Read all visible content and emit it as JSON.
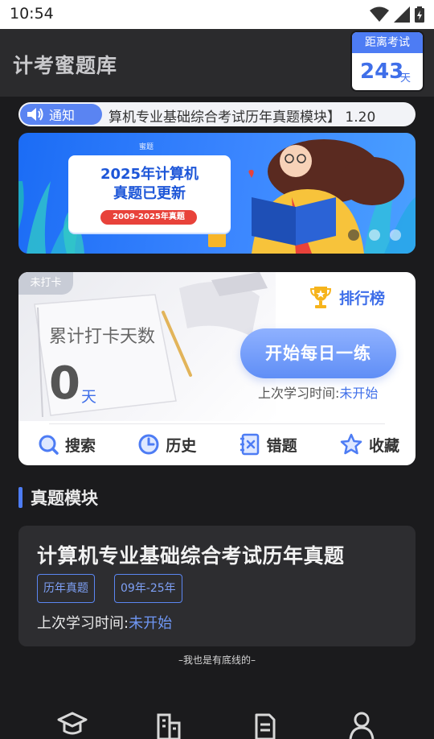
{
  "status_bar": {
    "time": "10:54",
    "icons": [
      "wifi-icon",
      "signal-icon",
      "battery-icon"
    ]
  },
  "app_bar": {
    "title": "计考蜜题库",
    "countdown": {
      "label": "距离考试",
      "value": "243",
      "unit": "天"
    }
  },
  "notice": {
    "tag": "通知",
    "text": "算机专业基础综合考试历年真题模块】 1.20"
  },
  "banner": {
    "brand": "蜜题",
    "headline_line1": "2025年计算机",
    "headline_line2": "真题已更新",
    "pill": "2009-2025年真题",
    "pages": 3,
    "active_page": 1
  },
  "checkin": {
    "badge": "未打卡",
    "ranking_label": "排行榜",
    "days_label": "累计打卡天数",
    "days_value": "0",
    "days_unit": "天",
    "start_button": "开始每日一练",
    "last_study_label": "上次学习时间:",
    "last_study_value": "未开始",
    "tools": [
      {
        "label": "搜索",
        "icon": "search-icon"
      },
      {
        "label": "历史",
        "icon": "clock-icon"
      },
      {
        "label": "错题",
        "icon": "wrong-question-icon"
      },
      {
        "label": "收藏",
        "icon": "star-icon"
      }
    ]
  },
  "section": {
    "title": "真题模块"
  },
  "module": {
    "name": "计算机专业基础综合考试历年真题",
    "tags": [
      "历年真题",
      "09年-25年"
    ],
    "last_study_label": "上次学习时间:",
    "last_study_value": "未开始"
  },
  "footer_note": "–我也是有底线的–",
  "tab_bar": {
    "icons": [
      "graduation-cap-icon",
      "building-icon",
      "document-icon",
      "user-icon"
    ]
  },
  "colors": {
    "accent": "#4d7cf4",
    "background": "#1b1b1d",
    "card_dark": "#2d2d30"
  }
}
